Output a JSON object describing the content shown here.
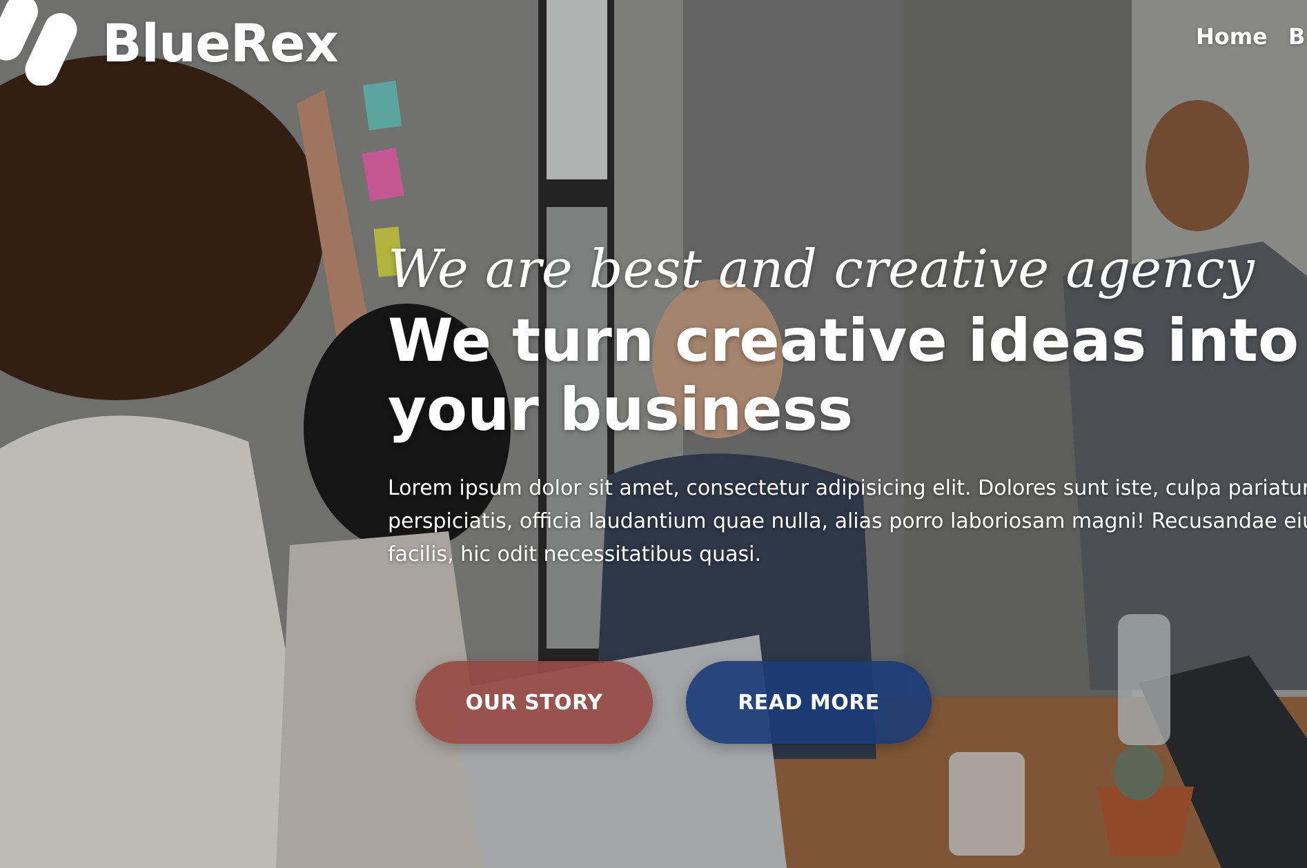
{
  "brand": {
    "name": "BlueRex",
    "logo_icon": "bluerex-logo-icon"
  },
  "nav": {
    "items": [
      {
        "label": "Home"
      },
      {
        "label": "B"
      }
    ]
  },
  "hero": {
    "tagline": "We are best and creative agency",
    "headline": "We turn creative ideas into your business",
    "lead": "Lorem ipsum dolor sit amet, consectetur adipisicing elit. Dolores sunt iste, culpa pariatur perspiciatis, officia laudantium quae nulla, alias porro laboriosam magni! Recusandae eius facilis, hic odit necessitatibus quasi.",
    "buttons": {
      "our_story": "OUR STORY",
      "read_more": "READ MORE"
    }
  },
  "colors": {
    "our_story_button": "#964640",
    "read_more_button": "#1c3c78",
    "text": "#ffffff"
  }
}
